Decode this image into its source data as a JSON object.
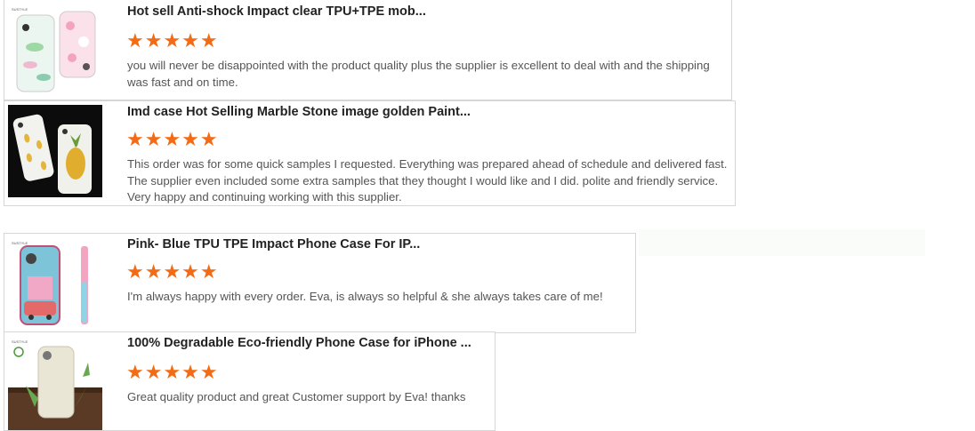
{
  "reviews": [
    {
      "title": "Hot sell Anti-shock Impact clear TPU+TPE mob...",
      "stars": "★★★★★",
      "rating": 5,
      "text": "you will never be disappointed with the product quality plus the supplier is excellent to deal with and the shipping was fast and on time.",
      "thumb_label": "SUSTYLE"
    },
    {
      "title": "Imd case Hot Selling Marble Stone image golden Paint...",
      "stars": "★★★★★",
      "rating": 5,
      "text": "This order was for some quick samples I requested. Everything was prepared ahead of schedule and delivered fast. The supplier even included some extra samples that they thought I would like and I did. polite and friendly service. Very happy and continuing working with this supplier.",
      "thumb_label": ""
    },
    {
      "title": "Pink- Blue TPU TPE Impact Phone Case For IP...",
      "stars": "★★★★★",
      "rating": 5,
      "text": "I'm always happy with every order. Eva, is always so helpful & she always takes care of me!",
      "thumb_label": "SUSTYLE"
    },
    {
      "title": "100% Degradable Eco-friendly Phone Case for iPhone ...",
      "stars": "★★★★★",
      "rating": 5,
      "text": "Great quality product and great Customer support by Eva! thanks",
      "thumb_label": "SUSTYLE"
    }
  ],
  "colors": {
    "star": "#f36b15",
    "title": "#222222",
    "text": "#555555",
    "border": "#d6d6d6"
  },
  "icons": [
    "star-icon",
    "recycle-icon"
  ]
}
